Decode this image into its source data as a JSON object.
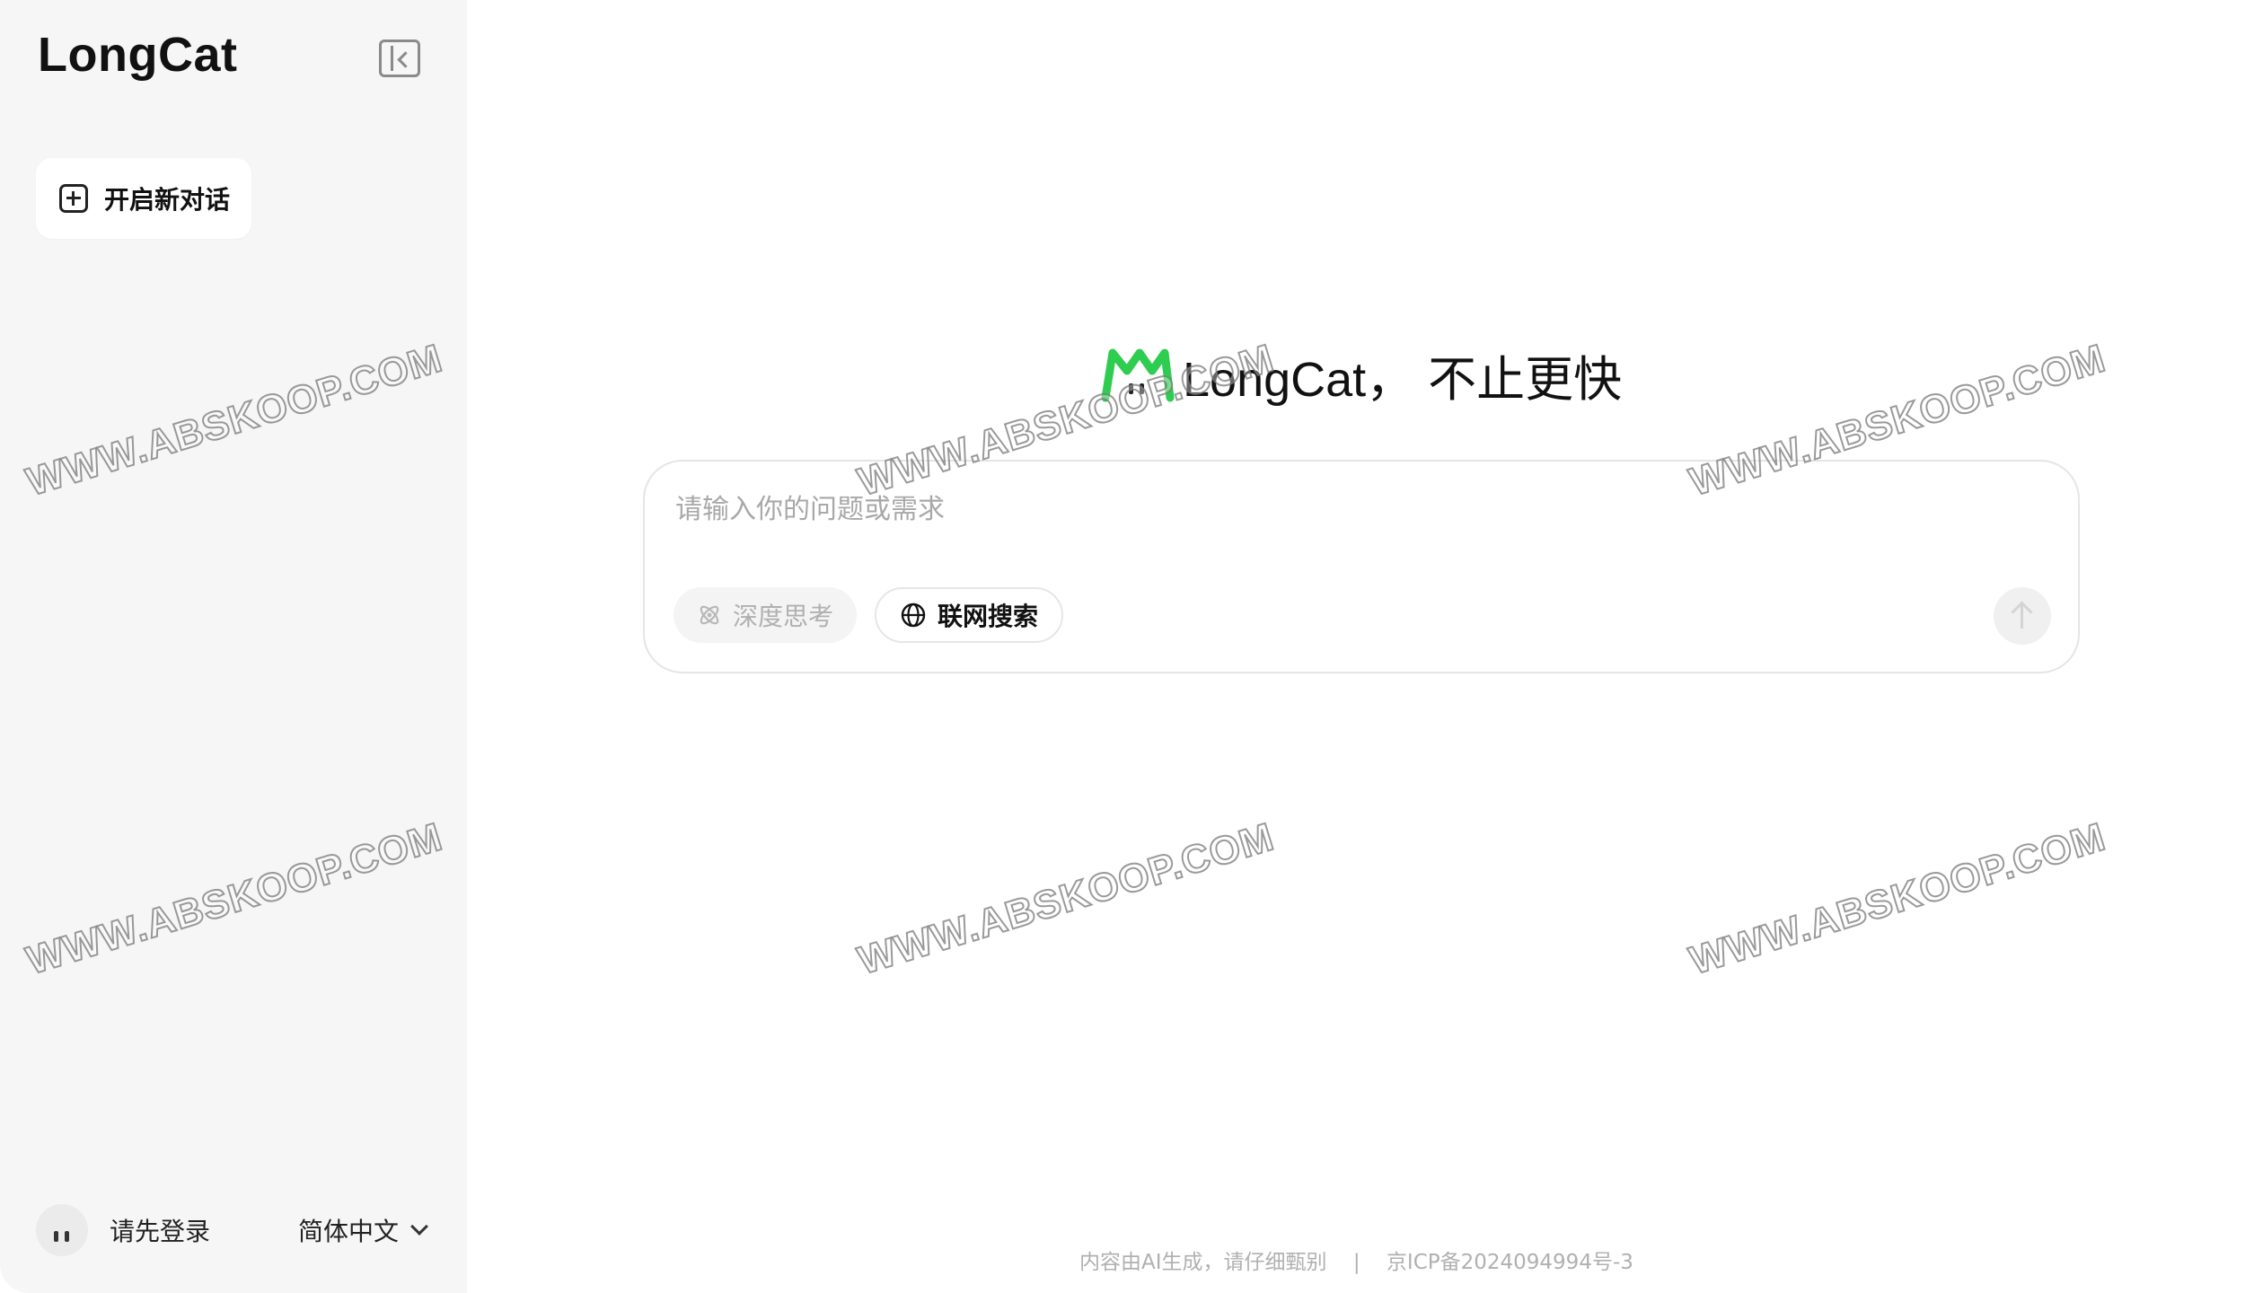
{
  "sidebar": {
    "brand": "LongCat",
    "collapse_icon": "sidebar-collapse-icon",
    "new_chat_label": "开启新对话",
    "login_label": "请先登录",
    "language": "简体中文"
  },
  "main": {
    "hero_title": "LongCat， 不止更快",
    "input_placeholder": "请输入你的问题或需求",
    "deep_think_label": "深度思考",
    "web_search_label": "联网搜索",
    "footer_disclaimer": "内容由AI生成，请仔细甄别",
    "footer_separator": "|",
    "footer_icp": "京ICP备2024094994号-3"
  },
  "colors": {
    "accent_green": "#2ecc4f",
    "sidebar_bg": "#f6f6f6"
  },
  "watermark_text": "WWW.ABSKOOP.COM"
}
